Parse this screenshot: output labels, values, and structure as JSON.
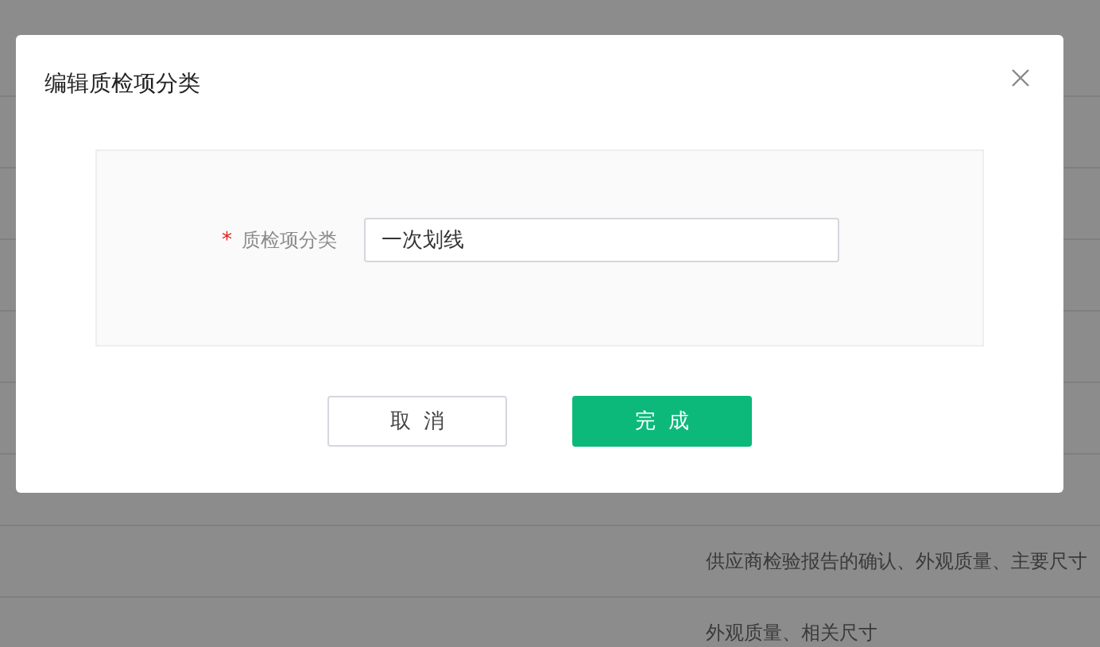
{
  "background_table": {
    "rows": [
      {
        "text": "供应商检验报告的确认、外观质量、主要尺寸"
      },
      {
        "text": "外观质量、相关尺寸"
      }
    ]
  },
  "dialog": {
    "title": "编辑质检项分类",
    "fields": [
      {
        "label": "质检项分类",
        "required_mark": "*",
        "value": "一次划线"
      }
    ],
    "buttons": [
      {
        "label": "取消",
        "kind": "secondary"
      },
      {
        "label": "完成",
        "kind": "primary"
      }
    ]
  }
}
